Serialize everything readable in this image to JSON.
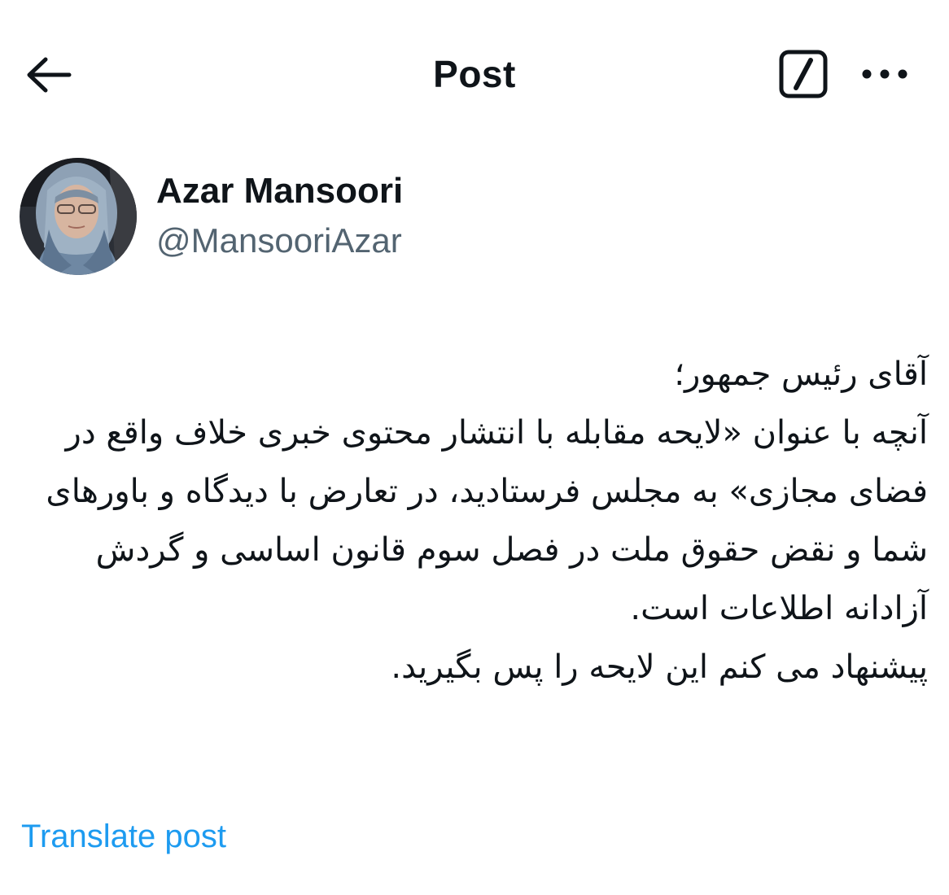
{
  "header": {
    "title": "Post",
    "back_icon": "arrow-left-icon",
    "grok_icon": "grok-slash-icon",
    "more_icon": "more-horizontal-icon"
  },
  "author": {
    "name": "Azar Mansoori",
    "handle": "@MansooriAzar",
    "avatar_icon": "avatar-photo"
  },
  "tweet": {
    "text": "آقای رئیس جمهور؛\nآنچه با عنوان «لایحه مقابله با انتشار محتوی خبری خلاف واقع در فضای مجازی» به مجلس فرستادید، در تعارض با دیدگاه و باورهای شما و نقض حقوق ملت در فصل سوم قانون اساسی و گردش آزادانه اطلاعات است.\nپیشنهاد می کنم این لایحه را پس بگیرید."
  },
  "actions": {
    "translate_label": "Translate post"
  },
  "colors": {
    "text": "#0f1419",
    "secondary": "#536471",
    "link": "#1d9bf0",
    "background": "#ffffff"
  }
}
